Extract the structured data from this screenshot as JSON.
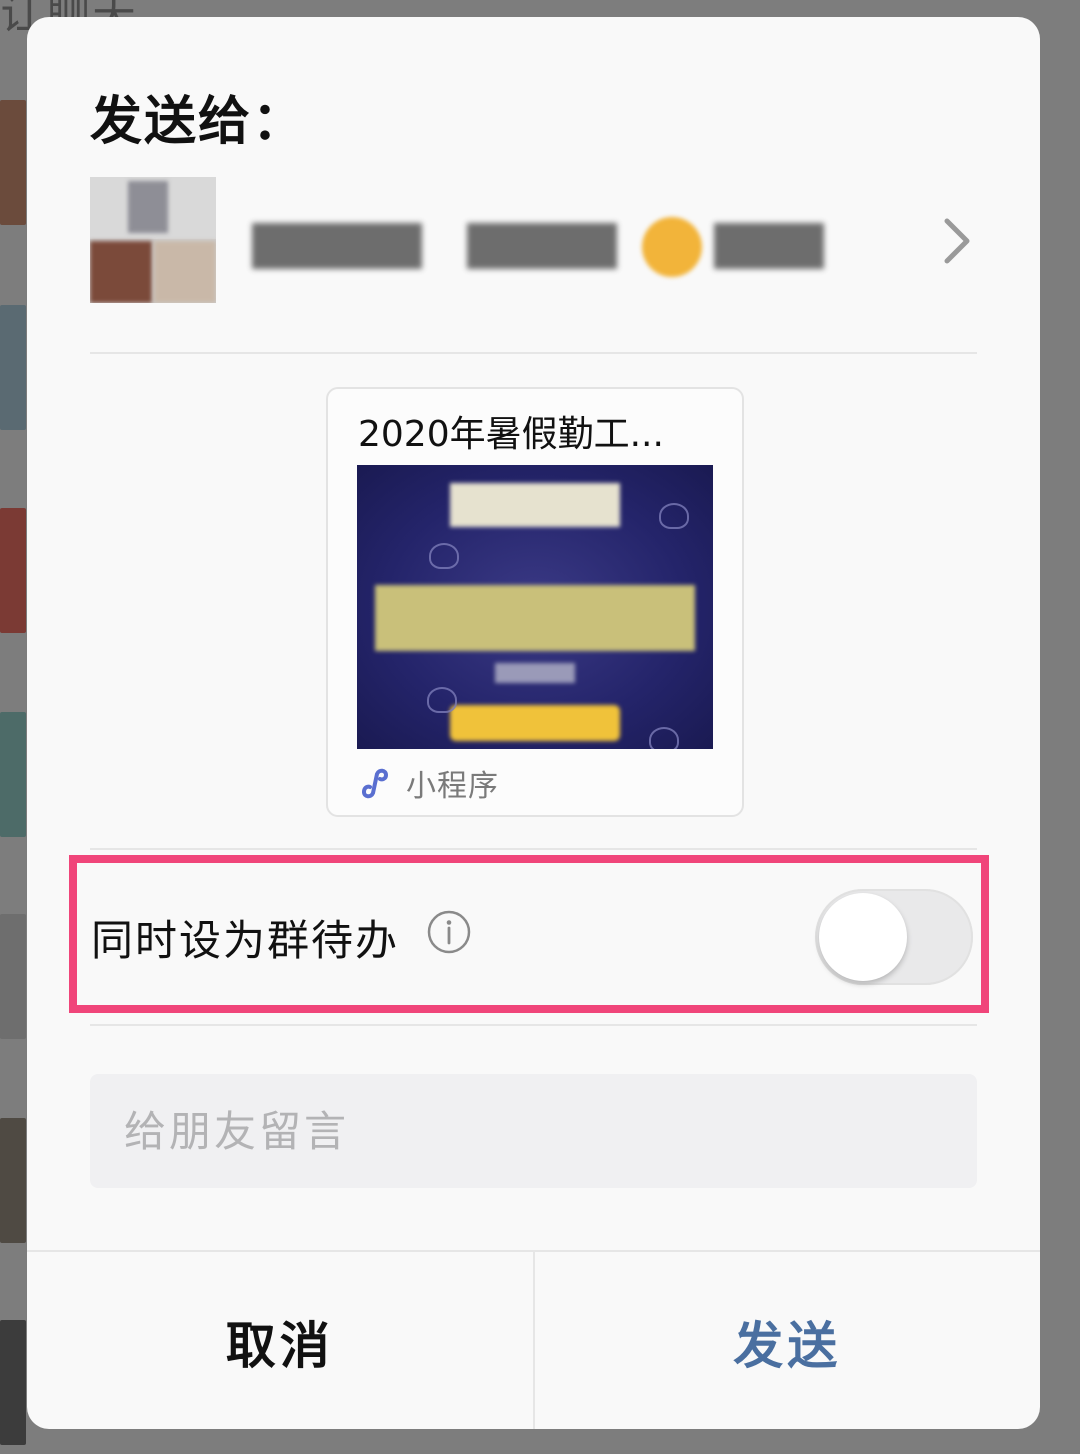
{
  "dialog": {
    "title": "发送给：",
    "recipient": {
      "name": "(blurred group name)"
    },
    "card": {
      "title": "2020年暑假勤工...",
      "type_label": "小程序"
    },
    "group_todo": {
      "label": "同时设为群待办",
      "enabled": false
    },
    "message": {
      "placeholder": "给朋友留言",
      "value": ""
    },
    "buttons": {
      "cancel": "取消",
      "send": "发送"
    }
  },
  "background": {
    "top_text": "讧聊天"
  },
  "colors": {
    "highlight_border": "#f0457a",
    "send_text": "#4a6fa0",
    "toggle_off": "#e9e9ea"
  }
}
